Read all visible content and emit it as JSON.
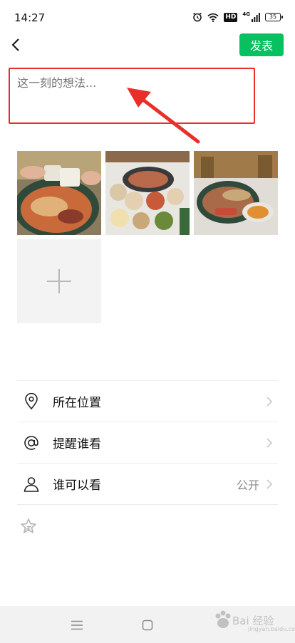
{
  "status_bar": {
    "time": "14:27",
    "icons": [
      "alarm-icon",
      "wifi-icon",
      "hd-icon",
      "signal-4g-icon",
      "battery-icon"
    ],
    "hd_label": "HD",
    "network_label": "4G",
    "battery_level": "35"
  },
  "nav": {
    "back_icon": "chevron-left-icon",
    "post_label": "发表",
    "post_color": "#07c160"
  },
  "composer": {
    "placeholder": "这一刻的想法...",
    "highlight_color": "#e8302a"
  },
  "photos": [
    {
      "name": "hotpot-photo-1"
    },
    {
      "name": "hotpot-photo-2"
    },
    {
      "name": "hotpot-photo-3"
    }
  ],
  "add_photo_icon": "plus-icon",
  "settings": [
    {
      "icon": "location-pin-icon",
      "label": "所在位置",
      "value": ""
    },
    {
      "icon": "at-sign-icon",
      "label": "提醒谁看",
      "value": ""
    },
    {
      "icon": "person-icon",
      "label": "谁可以看",
      "value": "公开"
    }
  ],
  "extra_icon": "star-icon",
  "system_nav": [
    "menu-icon",
    "home-square-icon",
    "back-triangle-icon"
  ],
  "watermark": {
    "text": "Bai 经验",
    "sub": "jingyan.baidu.com"
  }
}
